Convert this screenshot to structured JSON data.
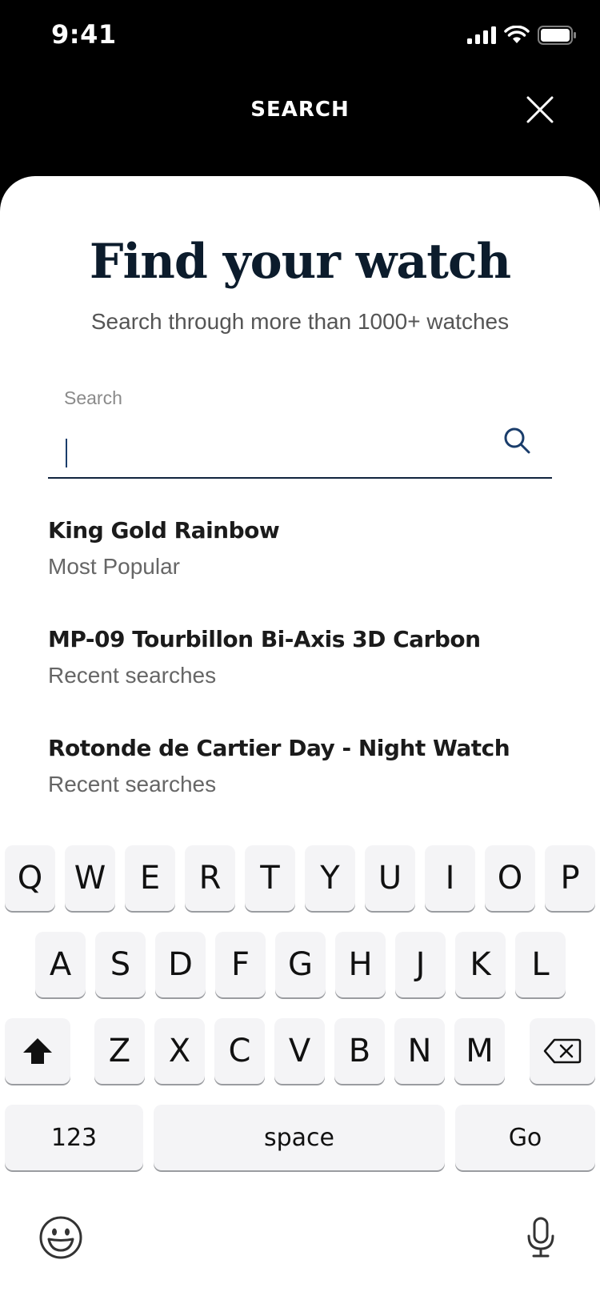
{
  "status": {
    "time": "9:41"
  },
  "nav": {
    "title": "SEARCH"
  },
  "heading": "Find your watch",
  "subheading": "Search through more than 1000+ watches",
  "search": {
    "label": "Search",
    "value": ""
  },
  "results": [
    {
      "title": "King Gold Rainbow",
      "subtitle": "Most Popular"
    },
    {
      "title": "MP-09 Tourbillon Bi-Axis 3D Carbon",
      "subtitle": "Recent searches"
    },
    {
      "title": "Rotonde de Cartier Day - Night Watch",
      "subtitle": "Recent searches"
    }
  ],
  "keyboard": {
    "row1": [
      "Q",
      "W",
      "E",
      "R",
      "T",
      "Y",
      "U",
      "I",
      "O",
      "P"
    ],
    "row2": [
      "A",
      "S",
      "D",
      "F",
      "G",
      "H",
      "J",
      "K",
      "L"
    ],
    "row3": [
      "Z",
      "X",
      "C",
      "V",
      "B",
      "N",
      "M"
    ],
    "numbers_label": "123",
    "space_label": "space",
    "go_label": "Go"
  },
  "colors": {
    "header_bg": "#000000",
    "heading": "#0c1c2c",
    "accent": "#10243e"
  },
  "icons": [
    "cellular-icon",
    "wifi-icon",
    "battery-icon",
    "close-icon",
    "search-icon",
    "shift-icon",
    "backspace-icon",
    "emoji-icon",
    "microphone-icon"
  ]
}
